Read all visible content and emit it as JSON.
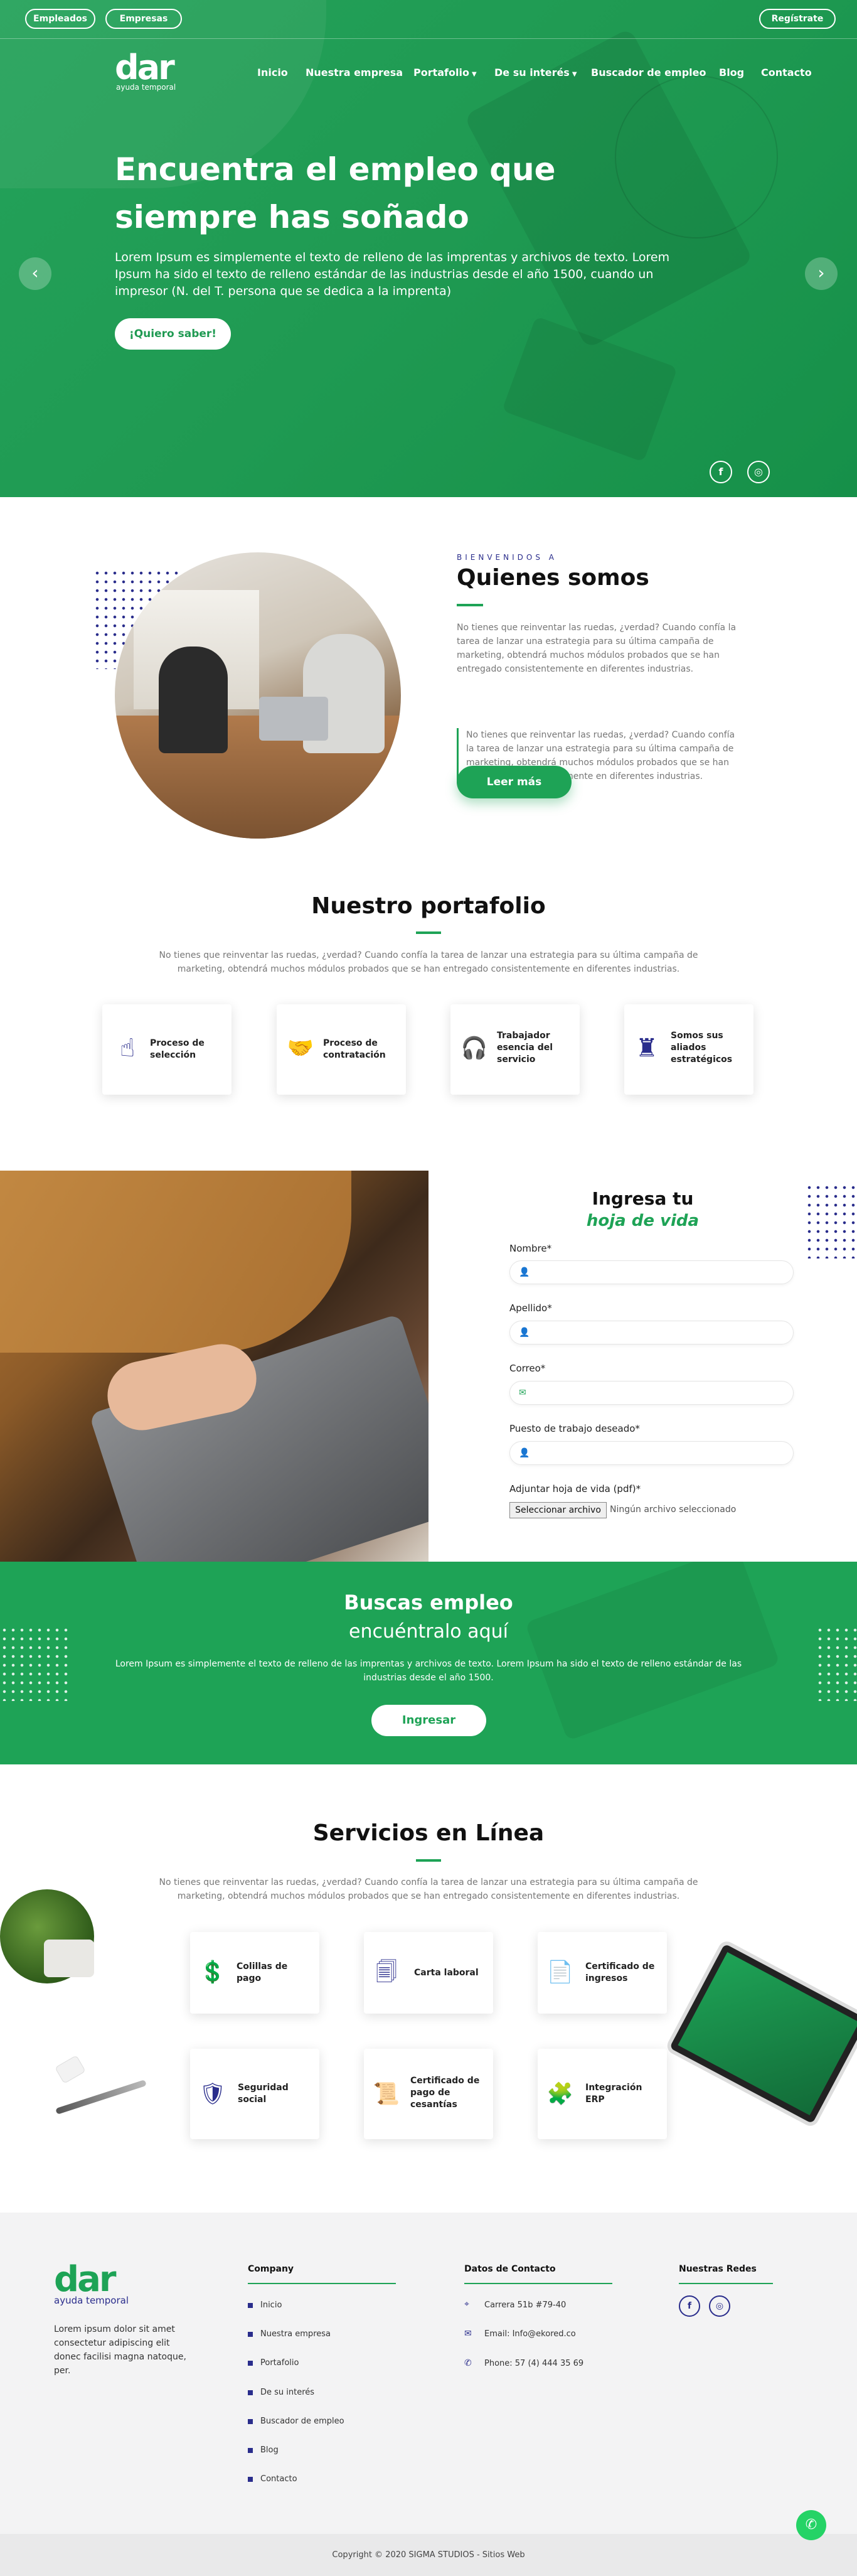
{
  "topbar": {
    "employees_label": "Empleados",
    "companies_label": "Empresas",
    "register_label": "Regístrate"
  },
  "brand": {
    "logo_text": "dar",
    "logo_tagline": "ayuda temporal"
  },
  "nav": {
    "items": [
      "Inicio",
      "Nuestra empresa",
      "Portafolio",
      "De su interés",
      "Buscador de empleo",
      "Blog",
      "Contacto"
    ]
  },
  "hero": {
    "title": "Encuentra el empleo que siempre has soñado",
    "text": "Lorem Ipsum es simplemente el texto de relleno de las imprentas y archivos de texto. Lorem Ipsum ha sido el texto de relleno estándar de las industrias desde el año 1500, cuando un impresor (N. del T. persona que se dedica a la imprenta)",
    "cta": "¡Quiero saber!",
    "prev": "‹",
    "next": "›",
    "social": [
      "f",
      "◎"
    ]
  },
  "about": {
    "eyebrow": "BIENVENIDOS A",
    "title": "Quienes somos",
    "p1": "No tienes que reinventar las ruedas, ¿verdad? Cuando confía la tarea de lanzar una estrategia para su última campaña de marketing, obtendrá muchos módulos probados que se han entregado consistentemente en diferentes industrias.",
    "quote": "No tienes que reinventar las ruedas, ¿verdad? Cuando confía la tarea de lanzar una estrategia para su última campaña de marketing, obtendrá muchos módulos probados que se han entregado consistentemente en diferentes industrias.",
    "button": "Leer más"
  },
  "portfolio": {
    "title": "Nuestro portafolio",
    "text": "No tienes que reinventar las ruedas, ¿verdad? Cuando confía la tarea de lanzar una estrategia para su última campaña de marketing, obtendrá muchos módulos probados que se han entregado consistentemente en diferentes industrias.",
    "cards": [
      {
        "label": "Proceso de selección",
        "icon": "pointer-hand-icon"
      },
      {
        "label": "Proceso de contratación",
        "icon": "handshake-icon"
      },
      {
        "label": "Trabajador esencia del servicio",
        "icon": "headset-icon"
      },
      {
        "label": "Somos sus aliados estratégicos",
        "icon": "chess-rook-icon"
      }
    ]
  },
  "form": {
    "title": "Ingresa tu",
    "subtitle": "hoja de vida",
    "fields": [
      {
        "label": "Nombre*",
        "icon": "user-icon"
      },
      {
        "label": "Apellido*",
        "icon": "user-icon"
      },
      {
        "label": "Correo*",
        "icon": "envelope-icon"
      },
      {
        "label": "Puesto de trabajo deseado*",
        "icon": "user-icon"
      }
    ],
    "file_label": "Adjuntar hoja de vida (pdf)*",
    "file_button": "Seleccionar archivo",
    "file_status": "Ningún archivo seleccionado"
  },
  "band": {
    "title": "Buscas empleo",
    "subtitle": "encuéntralo aquí",
    "text": "Lorem Ipsum es simplemente el texto de relleno de las imprentas y archivos de texto. Lorem Ipsum ha sido el texto de relleno estándar de las industrias desde el año 1500.",
    "button": "Ingresar"
  },
  "services": {
    "title": "Servicios en Línea",
    "text": "No tienes que reinventar las ruedas, ¿verdad? Cuando confía la tarea de lanzar una estrategia para su última campaña de marketing, obtendrá muchos módulos probados que se han entregado consistentemente en diferentes industrias.",
    "cards": [
      {
        "label": "Colillas de pago",
        "icon": "money-document-icon"
      },
      {
        "label": "Carta laboral",
        "icon": "documents-icon"
      },
      {
        "label": "Certificado de ingresos",
        "icon": "certificate-icon"
      },
      {
        "label": "Seguridad social",
        "icon": "shield-check-icon"
      },
      {
        "label": "Certificado de pago de cesantías",
        "icon": "payment-certificate-icon"
      },
      {
        "label": "Integración ERP",
        "icon": "puzzle-icon"
      }
    ]
  },
  "footer": {
    "about_text": "Lorem ipsum dolor sit amet consectetur adipiscing elit donec facilisi magna natoque, per.",
    "company_title": "Company",
    "company_links": [
      "Inicio",
      "Nuestra empresa",
      "Portafolio",
      "De su interés",
      "Buscador de empleo",
      "Blog",
      "Contacto"
    ],
    "contact_title": "Datos de Contacto",
    "contact": [
      {
        "text": "Carrera 51b #79-40",
        "icon": "location-pin-icon"
      },
      {
        "text": "Email: Info@ekored.co",
        "icon": "envelope-icon"
      },
      {
        "text": "Phone: 57 (4) 444 35 69",
        "icon": "phone-icon"
      }
    ],
    "social_title": "Nuestras Redes",
    "social": [
      "f",
      "◎"
    ],
    "copyright": "Copyright © 2020  SIGMA STUDIOS  - Sitios Web"
  },
  "colors": {
    "green": "#1ea356",
    "navy": "#2a2d8c"
  }
}
